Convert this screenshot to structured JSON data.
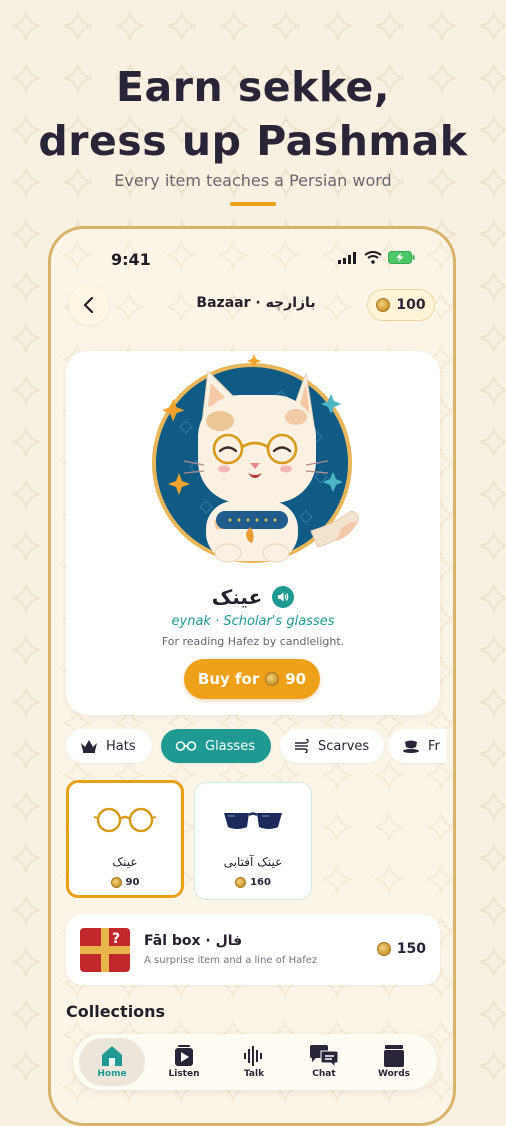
{
  "hero": {
    "title_line1": "Earn sekke,",
    "title_line2": "dress up Pashmak",
    "subtitle": "Every item teaches a Persian word"
  },
  "status_bar": {
    "time": "9:41"
  },
  "header": {
    "title": "Bazaar · بازارچه",
    "coins": "100"
  },
  "featured": {
    "persian": "عینک",
    "translit": "eynak · Scholar's glasses",
    "description": "For reading Hafez by candlelight.",
    "buy_label": "Buy for",
    "price": "90"
  },
  "tabs": [
    {
      "label": "Hats",
      "icon": "crown-icon",
      "active": false
    },
    {
      "label": "Glasses",
      "icon": "glasses-icon",
      "active": true
    },
    {
      "label": "Scarves",
      "icon": "wind-icon",
      "active": false
    },
    {
      "label": "Fr",
      "icon": "teacup-icon",
      "active": false
    }
  ],
  "items": [
    {
      "name": "عینک",
      "price": "90",
      "selected": true
    },
    {
      "name": "عینک آفتابی",
      "price": "160",
      "selected": false
    }
  ],
  "fal_box": {
    "title": "Fāl box · فال",
    "subtitle": "A surprise item and a line of Hafez",
    "price": "150"
  },
  "collections_label": "Collections",
  "nav": [
    {
      "label": "Home",
      "icon": "home-icon",
      "active": true
    },
    {
      "label": "Listen",
      "icon": "play-icon",
      "active": false
    },
    {
      "label": "Talk",
      "icon": "waveform-icon",
      "active": false
    },
    {
      "label": "Chat",
      "icon": "chat-icon",
      "active": false
    },
    {
      "label": "Words",
      "icon": "book-stack-icon",
      "active": false
    }
  ],
  "colors": {
    "teal": "#1f9a93",
    "amber": "#eea019",
    "cream": "#f8f1e1"
  }
}
